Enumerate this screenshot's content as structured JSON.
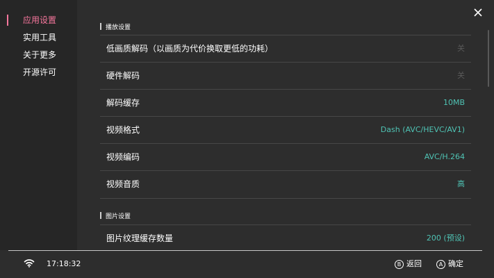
{
  "sidebar": {
    "items": [
      {
        "label": "应用设置",
        "active": true
      },
      {
        "label": "实用工具",
        "active": false
      },
      {
        "label": "关于更多",
        "active": false
      },
      {
        "label": "开源许可",
        "active": false
      }
    ]
  },
  "sections": [
    {
      "title": "播放设置",
      "rows": [
        {
          "label": "低画质解码（以画质为代价换取更低的功耗）",
          "value": "关",
          "state": "off"
        },
        {
          "label": "硬件解码",
          "value": "关",
          "state": "off"
        },
        {
          "label": "解码缓存",
          "value": "10MB",
          "state": "on"
        },
        {
          "label": "视频格式",
          "value": "Dash (AVC/HEVC/AV1)",
          "state": "on"
        },
        {
          "label": "视频编码",
          "value": "AVC/H.264",
          "state": "on"
        },
        {
          "label": "视频音质",
          "value": "高",
          "state": "on"
        }
      ]
    },
    {
      "title": "图片设置",
      "rows": [
        {
          "label": "图片纹理缓存数量",
          "value": "200 (预设)",
          "state": "on"
        }
      ]
    }
  ],
  "footer": {
    "time": "17:18:32",
    "back": {
      "glyph": "B",
      "label": "返回"
    },
    "confirm": {
      "glyph": "A",
      "label": "确定"
    }
  },
  "icons": {
    "close": "close-icon",
    "wifi": "wifi-icon"
  },
  "colors": {
    "accent": "#f7779d",
    "value": "#4fc3b4",
    "value_off": "#5a5a5a",
    "background": "#2d2d2d",
    "sidebar": "#262626"
  }
}
